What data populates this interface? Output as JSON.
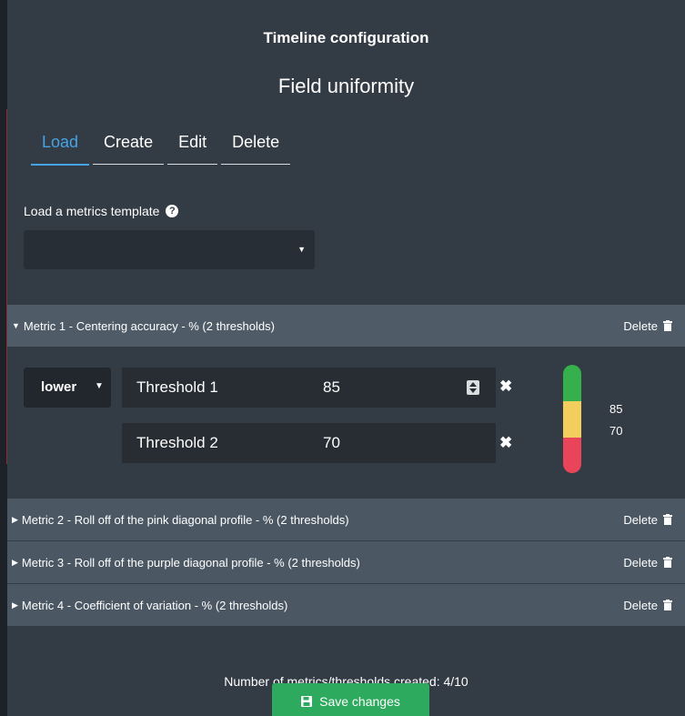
{
  "header": {
    "title": "Timeline configuration",
    "subtitle": "Field uniformity"
  },
  "tabs": [
    {
      "label": "Load",
      "active": true
    },
    {
      "label": "Create",
      "active": false
    },
    {
      "label": "Edit",
      "active": false
    },
    {
      "label": "Delete",
      "active": false
    }
  ],
  "template": {
    "label": "Load a metrics template",
    "help_icon": "question-circle-icon",
    "selected_value": ""
  },
  "metrics": [
    {
      "label": "Metric 1 - Centering accuracy - % (2 thresholds)",
      "expanded": true,
      "delete_label": "Delete",
      "direction": "lower",
      "thresholds": [
        {
          "name": "Threshold 1",
          "value": "85"
        },
        {
          "name": "Threshold 2",
          "value": "70"
        }
      ],
      "gauge": {
        "colors": [
          "#36b04c",
          "#f2cf5c",
          "#e9445a"
        ],
        "labels": [
          "85",
          "70"
        ]
      }
    },
    {
      "label": "Metric 2 - Roll off of the pink diagonal profile - % (2 thresholds)",
      "expanded": false,
      "delete_label": "Delete"
    },
    {
      "label": "Metric 3 - Roll off of the purple diagonal profile - % (2 thresholds)",
      "expanded": false,
      "delete_label": "Delete"
    },
    {
      "label": "Metric 4 - Coefficient of variation - % (2 thresholds)",
      "expanded": false,
      "delete_label": "Delete"
    }
  ],
  "footer": {
    "count_text": "Number of metrics/thresholds created: 4/10",
    "save_label": "Save changes"
  }
}
